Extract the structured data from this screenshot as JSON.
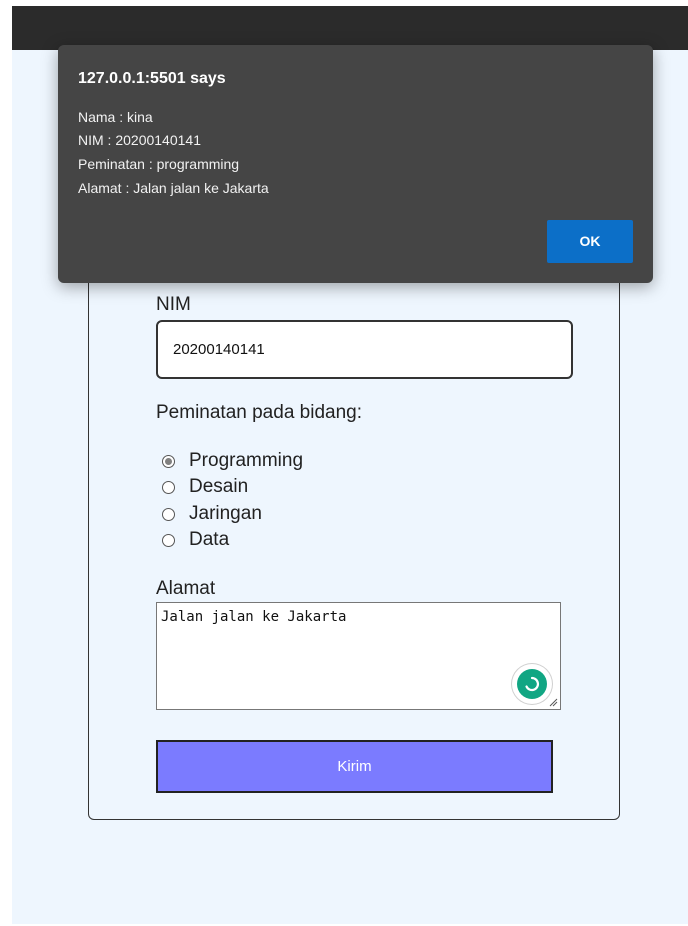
{
  "alert": {
    "title": "127.0.0.1:5501 says",
    "lines": [
      "Nama : kina",
      "NIM : 20200140141",
      "Peminatan : programming",
      "Alamat : Jalan jalan ke Jakarta"
    ],
    "ok_label": "OK"
  },
  "form": {
    "nim_label": "NIM",
    "nim_value": "20200140141",
    "interest_label": "Peminatan pada bidang:",
    "interests": [
      {
        "label": "Programming",
        "checked": true
      },
      {
        "label": "Desain",
        "checked": false
      },
      {
        "label": "Jaringan",
        "checked": false
      },
      {
        "label": "Data",
        "checked": false
      }
    ],
    "address_label": "Alamat",
    "address_value": "Jalan jalan ke Jakarta",
    "submit_label": "Kirim"
  },
  "colors": {
    "page_background": "#eef6fe",
    "submit_button": "#7b7bff",
    "ok_button": "#0c6fc8",
    "dialog_background": "#454545"
  }
}
